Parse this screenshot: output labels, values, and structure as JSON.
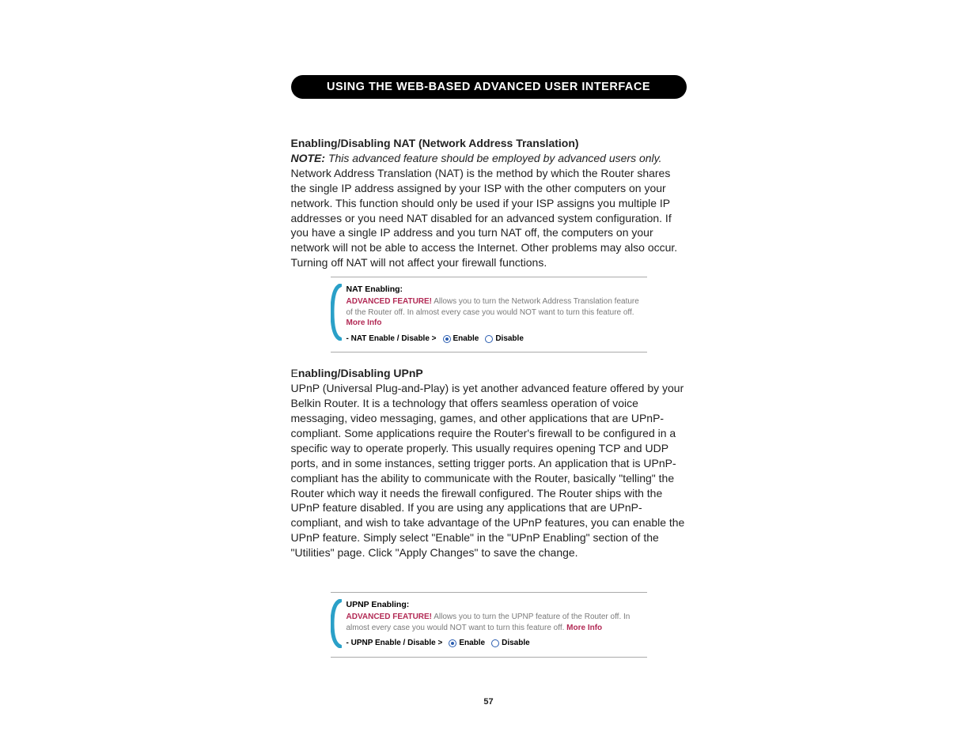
{
  "banner": "USING THE WEB-BASED ADVANCED USER INTERFACE",
  "nat": {
    "heading": "Enabling/Disabling NAT (Network Address Translation)",
    "note_label": "NOTE:",
    "note_italic": " This advanced feature should be employed by advanced users only.",
    "body": " Network Address Translation (NAT) is the method by which the Router shares the single IP address assigned by your ISP with the other computers on your network. This function should only be used if your ISP assigns you multiple IP addresses or you need NAT disabled for an advanced system configuration. If you have a single IP address and you turn NAT off, the computers on your network will not be able to access the Internet. Other problems may also occur. Turning off NAT will not affect your firewall functions.",
    "panel": {
      "title": "NAT Enabling:",
      "adv_label": "ADVANCED FEATURE!",
      "adv_text": " Allows you to turn the Network Address Translation feature of the Router off. In almost every case you would NOT want to turn this feature off. ",
      "more_info": "More Info",
      "control_label": "- NAT Enable / Disable >",
      "enable": "Enable",
      "disable": "Disable"
    }
  },
  "upnp": {
    "heading_prefix": "E",
    "heading_rest": "nabling/Disabling UPnP",
    "body": "UPnP (Universal Plug-and-Play) is yet another advanced feature offered by your Belkin Router. It is a technology that offers seamless operation of voice messaging, video messaging, games, and other applications that are UPnP-compliant. Some applications require the Router's firewall to be configured in a specific way to operate properly. This usually requires opening TCP and UDP ports, and in some instances, setting trigger ports. An application that is UPnP-compliant has the ability to communicate with the Router, basically \"telling\" the Router which way it needs the firewall configured. The Router ships with the UPnP feature disabled. If you are using any applications that are UPnP-compliant, and wish to take advantage of the UPnP features, you can enable the UPnP feature. Simply select \"Enable\" in the \"UPnP Enabling\" section of the \"Utilities\" page. Click \"Apply Changes\" to save the change.",
    "panel": {
      "title": "UPNP Enabling:",
      "adv_label": "ADVANCED FEATURE!",
      "adv_text": " Allows you to turn the UPNP feature of the Router off. In almost every case you would NOT want to turn this feature off. ",
      "more_info": "More Info",
      "control_label": "- UPNP Enable / Disable >",
      "enable": "Enable",
      "disable": "Disable"
    }
  },
  "page_number": "57"
}
